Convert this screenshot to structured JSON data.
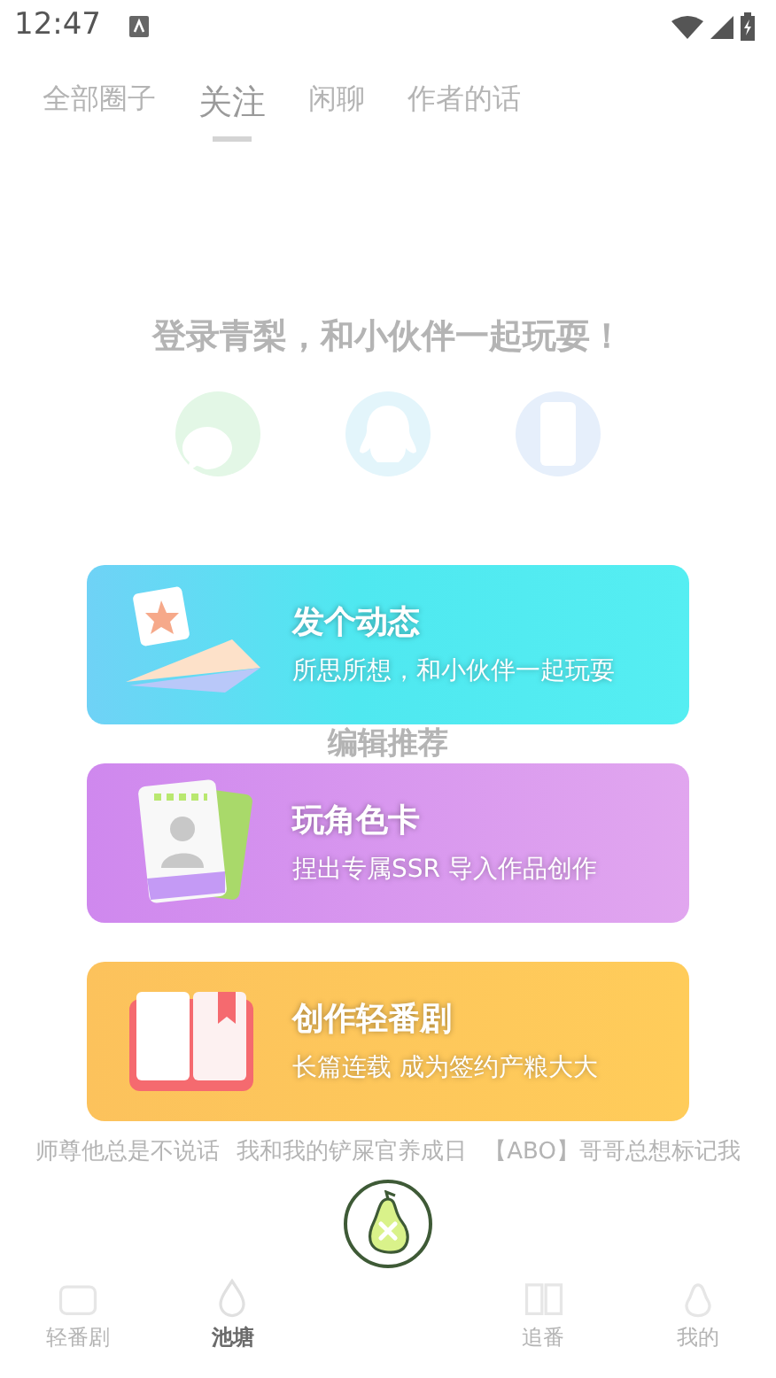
{
  "status_bar": {
    "time": "12:47"
  },
  "tabs": [
    {
      "label": "全部圈子",
      "selected": false
    },
    {
      "label": "关注",
      "selected": true
    },
    {
      "label": "闲聊",
      "selected": false
    },
    {
      "label": "作者的话",
      "selected": false
    }
  ],
  "login": {
    "title": "登录青梨，和小伙伴一起玩耍！",
    "methods": [
      {
        "kind": "wechat",
        "color": "#e3f7e6"
      },
      {
        "kind": "qq",
        "color": "#e3f5fb"
      },
      {
        "kind": "phone",
        "color": "#e6effb"
      }
    ]
  },
  "section_title": "编辑推荐",
  "actions": [
    {
      "kind": "post",
      "title": "发个动态",
      "subtitle": "所思所想，和小伙伴一起玩耍"
    },
    {
      "kind": "card",
      "title": "玩角色卡",
      "subtitle": "捏出专属SSR 导入作品创作"
    },
    {
      "kind": "drama",
      "title": "创作轻番剧",
      "subtitle": "长篇连载 成为签约产粮大大"
    }
  ],
  "stories": [
    {
      "title": "师尊他总是不说话"
    },
    {
      "title": "我和我的铲屎官养成日"
    },
    {
      "title": "【ABO】哥哥总想标记我"
    }
  ],
  "bottom_nav": [
    {
      "label": "轻番剧",
      "kind": "tv",
      "selected": false
    },
    {
      "label": "池塘",
      "kind": "drop",
      "selected": true
    },
    {
      "kind": "center"
    },
    {
      "label": "追番",
      "kind": "book",
      "selected": false
    },
    {
      "label": "我的",
      "kind": "pear",
      "selected": false
    }
  ]
}
